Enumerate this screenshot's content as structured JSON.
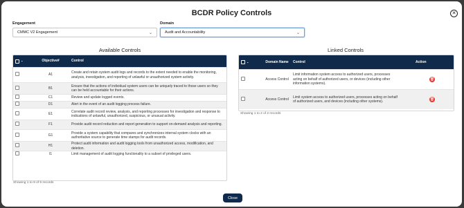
{
  "dialog": {
    "title": "BCDR Policy Controls",
    "close_icon": "close-icon",
    "close_button": "Close"
  },
  "filters": {
    "engagement": {
      "label": "Engagement",
      "value": "CMMC V2 Engagement"
    },
    "domain": {
      "label": "Domain",
      "value": "Audit and Accountability"
    }
  },
  "available": {
    "title": "Available Controls",
    "headers": {
      "objective": "Objective#",
      "control": "Control"
    },
    "rows": [
      {
        "objective": "A1",
        "control": "Create and retain system audit logs and records to the extent needed to enable the monitoring, analysis, investigation, and reporting of unlawful or unauthorized system activity."
      },
      {
        "objective": "B1",
        "control": "Ensure that the actions of individual system users can be uniquely traced to those users so they can be held accountable for their actions."
      },
      {
        "objective": "C1",
        "control": "Review and update logged events."
      },
      {
        "objective": "D1",
        "control": "Alert in the event of an audit logging process failure."
      },
      {
        "objective": "E1",
        "control": "Correlate audit record review, analysis, and reporting processes for investigation and response to indications of unlawful, unauthorized, suspicious, or unusual activity."
      },
      {
        "objective": "F1",
        "control": "Provide audit record reduction and report generation to support on-demand analysis and reporting."
      },
      {
        "objective": "G1",
        "control": "Provide a system capability that compares and synchronizes internal system clocks with an authoritative source to generate time stamps for audit records."
      },
      {
        "objective": "H1",
        "control": "Protect audit information and audit logging tools from unauthorized access, modification, and deletion."
      },
      {
        "objective": "I1",
        "control": "Limit management of audit logging functionality to a subset of privileged users."
      }
    ],
    "footer": "Showing 1 to 9 of 9 records"
  },
  "linked": {
    "title": "Linked Controls",
    "headers": {
      "domain": "Domain Name",
      "control": "Control",
      "action": "Action"
    },
    "rows": [
      {
        "domain": "Access Control",
        "control": "Limit information system access to authorized users, processes acting on behalf of authorized users, or devices (including other information systems)."
      },
      {
        "domain": "Access Control",
        "control": "Limit system access to authorized users, processes acting on behalf of authorized users, and devices (including other systems)."
      }
    ],
    "footer": "Showing 1 to 2 of 2 records"
  },
  "colors": {
    "header_bg": "#0f2a4a",
    "delete": "#e53935"
  }
}
